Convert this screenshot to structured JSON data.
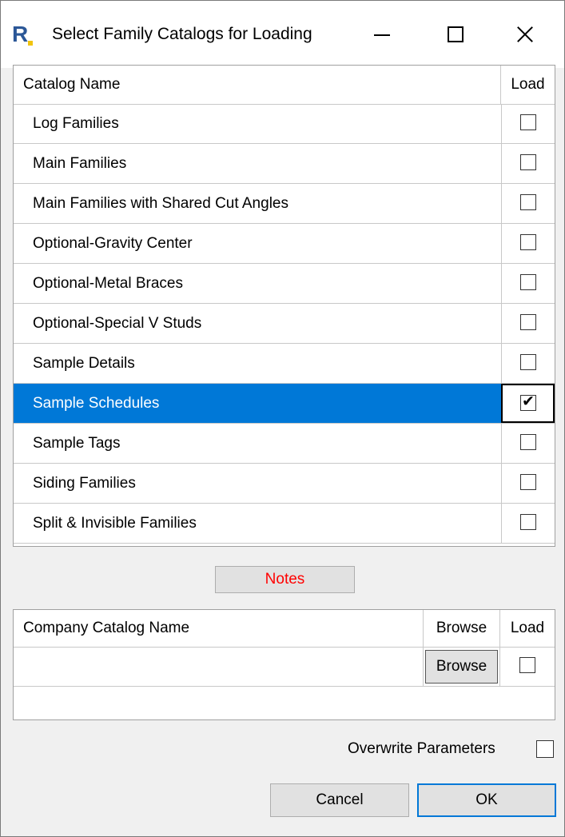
{
  "window": {
    "title": "Select Family Catalogs for Loading",
    "icon_letter": "R",
    "accent_color": "#0078d7"
  },
  "catalog_grid": {
    "columns": {
      "name": "Catalog Name",
      "load": "Load"
    },
    "rows": [
      {
        "name": "Log Families",
        "load": false,
        "selected": false
      },
      {
        "name": "Main Families",
        "load": false,
        "selected": false
      },
      {
        "name": "Main Families with Shared Cut Angles",
        "load": false,
        "selected": false
      },
      {
        "name": "Optional-Gravity Center",
        "load": false,
        "selected": false
      },
      {
        "name": "Optional-Metal Braces",
        "load": false,
        "selected": false
      },
      {
        "name": "Optional-Special V Studs",
        "load": false,
        "selected": false
      },
      {
        "name": "Sample Details",
        "load": false,
        "selected": false
      },
      {
        "name": "Sample Schedules",
        "load": true,
        "selected": true
      },
      {
        "name": "Sample Tags",
        "load": false,
        "selected": false
      },
      {
        "name": "Siding Families",
        "load": false,
        "selected": false
      },
      {
        "name": "Split & Invisible Families",
        "load": false,
        "selected": false
      }
    ]
  },
  "notes_button": {
    "label": "Notes",
    "color": "#ff0000"
  },
  "company_grid": {
    "columns": {
      "name": "Company Catalog Name",
      "browse": "Browse",
      "load": "Load"
    },
    "rows": [
      {
        "name": "",
        "browse_label": "Browse",
        "load": false
      }
    ]
  },
  "overwrite": {
    "label": "Overwrite Parameters",
    "checked": false
  },
  "buttons": {
    "cancel": "Cancel",
    "ok": "OK"
  }
}
